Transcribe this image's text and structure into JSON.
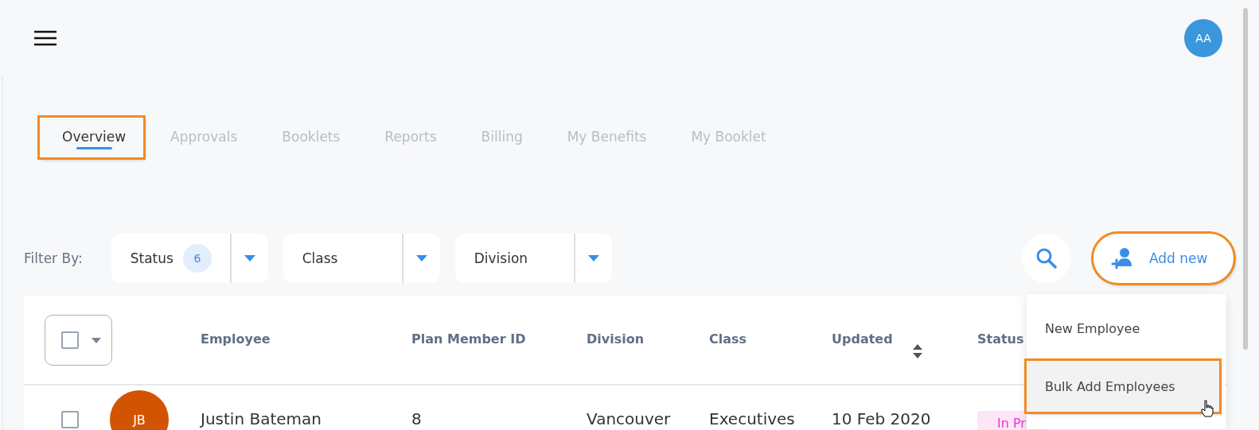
{
  "header": {
    "avatar": "AA"
  },
  "tabs": [
    {
      "label": "Overview",
      "selected": true,
      "highlighted": true
    },
    {
      "label": "Approvals",
      "selected": false,
      "highlighted": false
    },
    {
      "label": "Booklets",
      "selected": false,
      "highlighted": false
    },
    {
      "label": "Reports",
      "selected": false,
      "highlighted": false
    },
    {
      "label": "Billing",
      "selected": false,
      "highlighted": false
    },
    {
      "label": "My Benefits",
      "selected": false,
      "highlighted": false
    },
    {
      "label": "My Booklet",
      "selected": false,
      "highlighted": false
    }
  ],
  "filter": {
    "label": "Filter By:",
    "dropdowns": [
      {
        "label": "Status",
        "count": "6"
      },
      {
        "label": "Class"
      },
      {
        "label": "Division"
      }
    ]
  },
  "add_button": {
    "label": "Add new",
    "highlighted": true
  },
  "table": {
    "select_all": {
      "checked": false
    },
    "columns": [
      {
        "label": "Employee",
        "sortable": false
      },
      {
        "label": "Plan Member ID",
        "sortable": false
      },
      {
        "label": "Division",
        "sortable": false
      },
      {
        "label": "Class",
        "sortable": false
      },
      {
        "label": "Updated",
        "sortable": true
      },
      {
        "label": "Status"
      }
    ],
    "rows": [
      {
        "checked": false,
        "initials": "JB",
        "employee": "Justin Bateman",
        "plan_member_id": "8",
        "division": "Vancouver",
        "class": "Executives",
        "updated": "10 Feb 2020",
        "status": "In Pr"
      }
    ]
  },
  "menu": {
    "items": [
      {
        "label": "New Employee",
        "hovered": false,
        "highlighted": false
      },
      {
        "label": "Bulk Add Employees",
        "hovered": true,
        "highlighted": true
      }
    ]
  }
}
